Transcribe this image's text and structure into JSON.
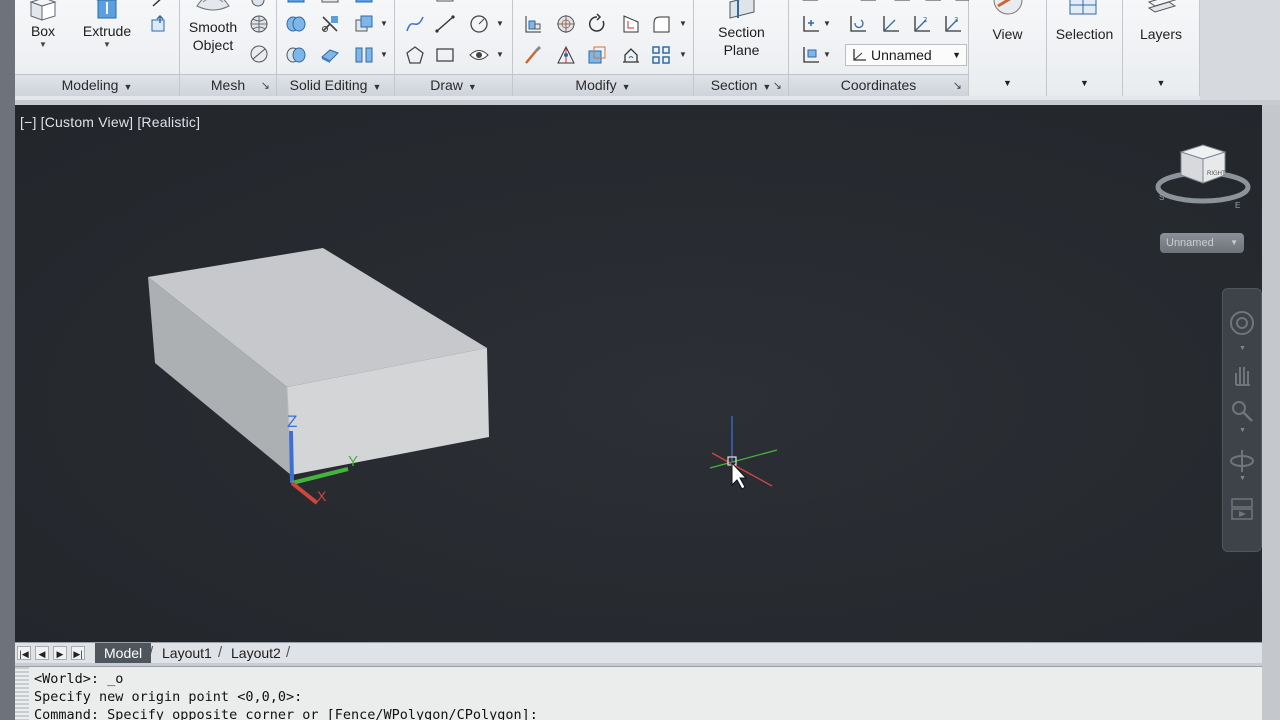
{
  "ribbon": {
    "modeling": {
      "title": "Modeling",
      "box_label": "Box",
      "extrude_label": "Extrude"
    },
    "mesh": {
      "title": "Mesh",
      "smooth_line1": "Smooth",
      "smooth_line2": "Object"
    },
    "solid_editing": {
      "title": "Solid Editing"
    },
    "draw": {
      "title": "Draw"
    },
    "modify": {
      "title": "Modify"
    },
    "section": {
      "title": "Section",
      "plane_line1": "Section",
      "plane_line2": "Plane"
    },
    "coordinates": {
      "title": "Coordinates",
      "ucs_value": "Unnamed"
    },
    "view_label": "View",
    "selection_label": "Selection",
    "layers_label": "Layers"
  },
  "viewport": {
    "label": "[−] [Custom View] [Realistic]",
    "ucs_dropdown": "Unnamed",
    "viewcube_face": "RIGHT",
    "compass": {
      "s": "S",
      "e": "E"
    },
    "axis_labels": {
      "x": "X",
      "y": "Y",
      "z": "Z"
    }
  },
  "tabs": [
    "Model",
    "Layout1",
    "Layout2"
  ],
  "command": {
    "lines": [
      "<World>: _o",
      "Specify new origin point <0,0,0>:",
      "Command: Specify opposite corner or [Fence/WPolygon/CPolygon]:"
    ]
  },
  "colors": {
    "viewport_bg": "#262a2f",
    "x_axis": "#d2453d",
    "y_axis": "#46b43c",
    "z_axis": "#3d6fd2",
    "box_face_top": "#c7c9cc",
    "box_face_front": "#b5b7ba",
    "box_face_right": "#d1d3d5"
  }
}
